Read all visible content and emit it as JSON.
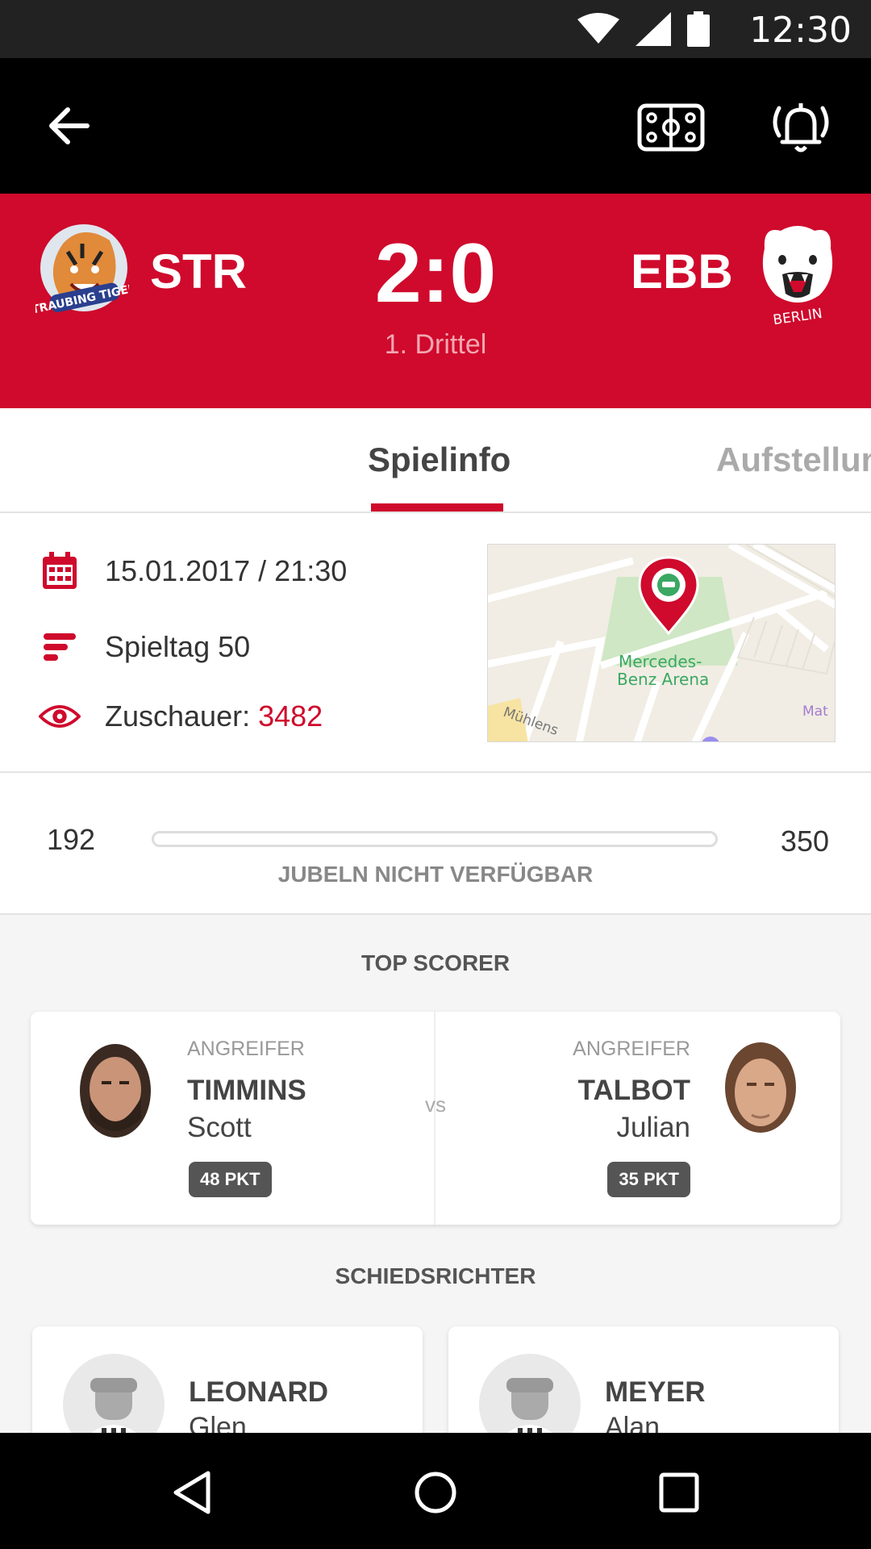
{
  "status_bar": {
    "time": "12:30"
  },
  "app_bar": {
    "back_icon": "arrow-left-icon",
    "rink_icon": "hockey-rink-icon",
    "alarm_icon": "alarm-bell-icon"
  },
  "match": {
    "home_team": "STR",
    "away_team": "EBB",
    "home_logo_text": "STRAUBING TIGERS",
    "away_logo_text": "BERLIN",
    "score": "2:0",
    "period": "1. Drittel"
  },
  "tabs": [
    {
      "label": "Spielinfo",
      "active": true
    },
    {
      "label": "Aufstellun",
      "active": false
    }
  ],
  "info": {
    "datetime": "15.01.2017 / 21:30",
    "matchday": "Spieltag 50",
    "spectators_label": "Zuschauer: ",
    "spectators_value": "3482",
    "map": {
      "venue_line1": "Mercedes-",
      "venue_line2": "Benz Arena",
      "street": "Mühlens",
      "poi": "Mat"
    }
  },
  "jubeln": {
    "left": "192",
    "right": "350",
    "caption": "JUBELN NICHT VERFÜGBAR"
  },
  "top_scorer": {
    "title": "TOP SCORER",
    "vs": "vs",
    "home": {
      "position": "ANGREIFER",
      "last": "TIMMINS",
      "first": "Scott",
      "points": "48 PKT"
    },
    "away": {
      "position": "ANGREIFER",
      "last": "TALBOT",
      "first": "Julian",
      "points": "35 PKT"
    }
  },
  "referees": {
    "title": "SCHIEDSRICHTER",
    "list": [
      {
        "last": "LEONARD",
        "first": "Glen"
      },
      {
        "last": "MEYER",
        "first": "Alan"
      }
    ]
  },
  "colors": {
    "accent": "#cf0a2c",
    "app_bar": "#000000",
    "status_bar": "#222222"
  }
}
